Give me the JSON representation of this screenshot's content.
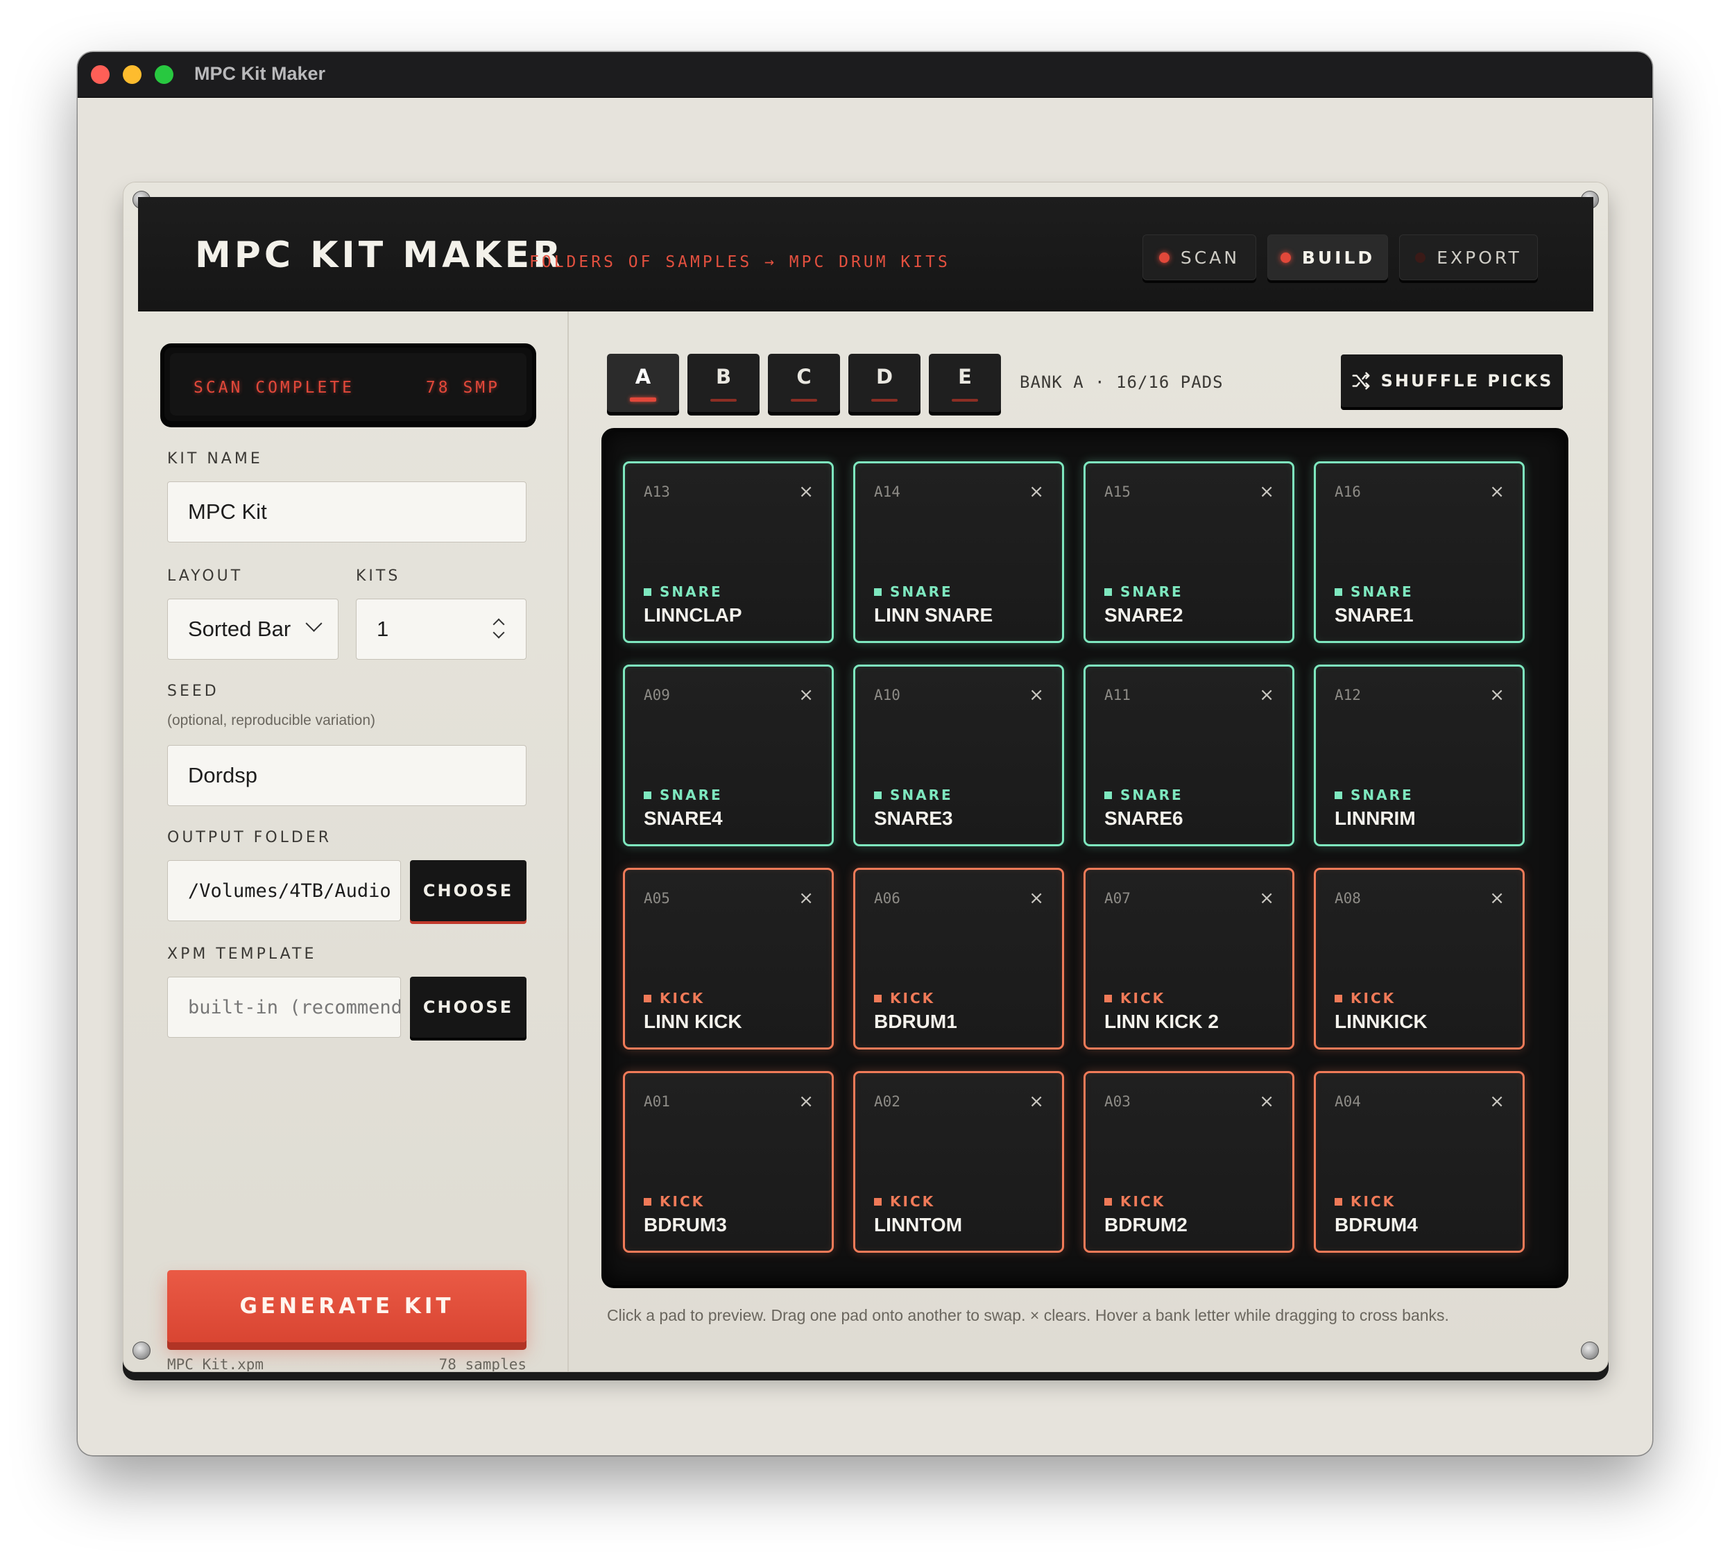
{
  "window": {
    "title": "MPC Kit Maker"
  },
  "header": {
    "title": "MPC KIT MAKER",
    "subtitle": "FOLDERS OF SAMPLES → MPC DRUM KITS",
    "buttons": [
      {
        "label": "SCAN",
        "led": "on"
      },
      {
        "label": "BUILD",
        "led": "on",
        "active": true
      },
      {
        "label": "EXPORT",
        "led": "off"
      }
    ]
  },
  "status": {
    "message": "SCAN COMPLETE",
    "count": "78 SMP"
  },
  "form": {
    "kit_name_label": "KIT NAME",
    "kit_name_value": "MPC Kit",
    "layout_label": "LAYOUT",
    "layout_value": "Sorted Bar",
    "kits_label": "KITS",
    "kits_value": "1",
    "seed_label": "SEED",
    "seed_hint": "(optional, reproducible variation)",
    "seed_value": "Dordsp",
    "output_label": "OUTPUT FOLDER",
    "output_value": "/Volumes/4TB/Audio",
    "output_button": "CHOOSE",
    "template_label": "XPM TEMPLATE",
    "template_placeholder": "built-in (recommended)",
    "template_button": "CHOOSE"
  },
  "generate": {
    "label": "GENERATE KIT",
    "file": "MPC Kit.xpm",
    "samples": "78 samples"
  },
  "banks": [
    "A",
    "B",
    "C",
    "D",
    "E"
  ],
  "active_bank": "A",
  "bank_info": "BANK A · 16/16 PADS",
  "shuffle_label": "SHUFFLE PICKS",
  "pads": [
    {
      "id": "A13",
      "category": "SNARE",
      "name": "LINNCLAP"
    },
    {
      "id": "A14",
      "category": "SNARE",
      "name": "LINN SNARE"
    },
    {
      "id": "A15",
      "category": "SNARE",
      "name": "SNARE2"
    },
    {
      "id": "A16",
      "category": "SNARE",
      "name": "SNARE1"
    },
    {
      "id": "A09",
      "category": "SNARE",
      "name": "SNARE4"
    },
    {
      "id": "A10",
      "category": "SNARE",
      "name": "SNARE3"
    },
    {
      "id": "A11",
      "category": "SNARE",
      "name": "SNARE6"
    },
    {
      "id": "A12",
      "category": "SNARE",
      "name": "LINNRIM"
    },
    {
      "id": "A05",
      "category": "KICK",
      "name": "LINN KICK"
    },
    {
      "id": "A06",
      "category": "KICK",
      "name": "BDRUM1"
    },
    {
      "id": "A07",
      "category": "KICK",
      "name": "LINN KICK 2"
    },
    {
      "id": "A08",
      "category": "KICK",
      "name": "LINNKICK"
    },
    {
      "id": "A01",
      "category": "KICK",
      "name": "BDRUM3"
    },
    {
      "id": "A02",
      "category": "KICK",
      "name": "LINNTOM"
    },
    {
      "id": "A03",
      "category": "KICK",
      "name": "BDRUM2"
    },
    {
      "id": "A04",
      "category": "KICK",
      "name": "BDRUM4"
    }
  ],
  "pad_clear_glyph": "×",
  "help_text": "Click a pad to preview. Drag one pad onto another to swap. × clears. Hover a bank letter while dragging to cross banks.",
  "colors": {
    "accent": "#e2483a",
    "snare": "#7ee8bf",
    "kick": "#f07a58",
    "generate": "#e4513d"
  }
}
